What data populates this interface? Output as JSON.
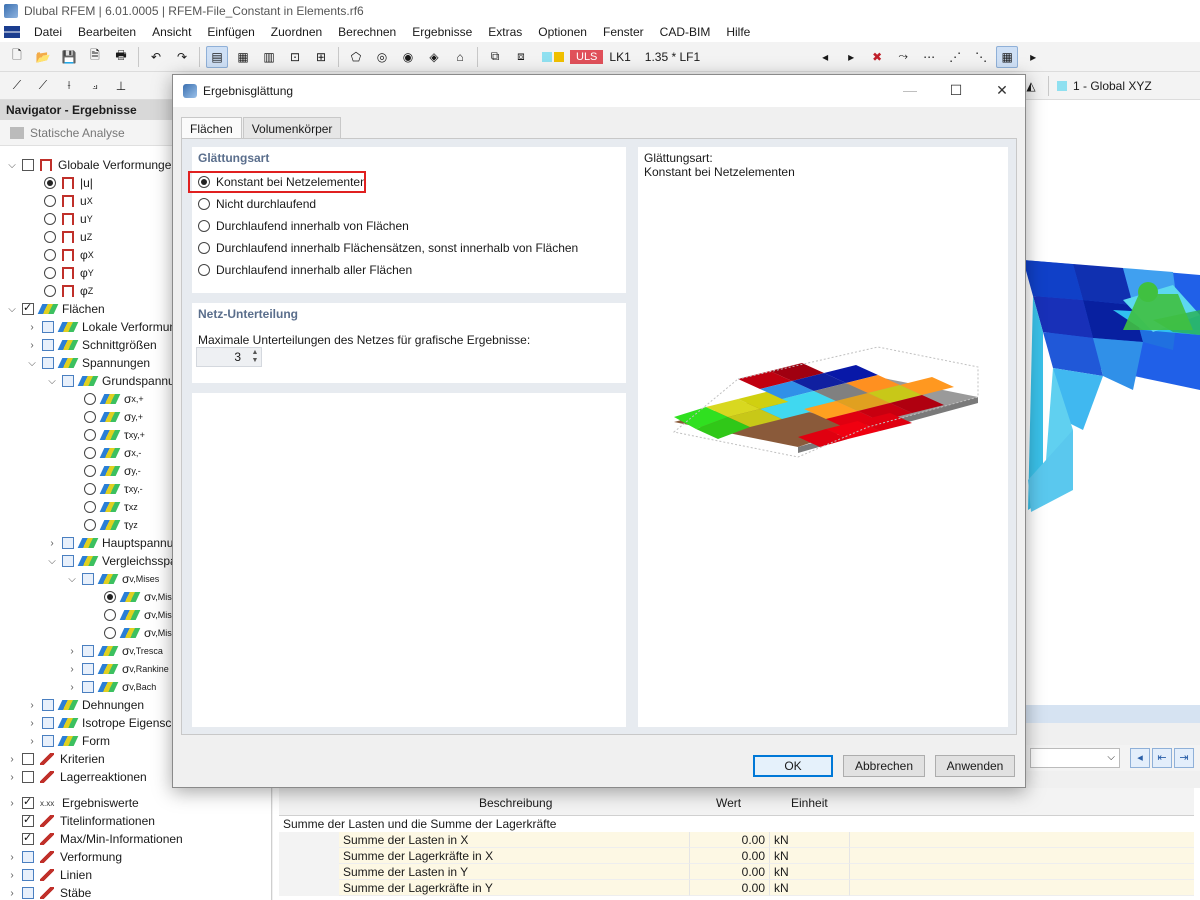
{
  "app_title": "Dlubal RFEM | 6.01.0005 | RFEM-File_Constant in Elements.rf6",
  "menu": [
    "Datei",
    "Bearbeiten",
    "Ansicht",
    "Einfügen",
    "Zuordnen",
    "Berechnen",
    "Ergebnisse",
    "Extras",
    "Optionen",
    "Fenster",
    "CAD-BIM",
    "Hilfe"
  ],
  "toolbar": {
    "uls": "ULS",
    "load_case": "LK1",
    "combination": "1.35 * LF1",
    "view_label": "1 - Global XYZ"
  },
  "navigator": {
    "title": "Navigator - Ergebnisse",
    "analysis": "Statische Analyse",
    "items": {
      "global_deform": "Globale Verformungen",
      "u_abs": "|u|",
      "ux_base": "u",
      "ux_sub": "X",
      "uy_base": "u",
      "uy_sub": "Y",
      "uz_base": "u",
      "uz_sub": "Z",
      "phix_base": "φ",
      "phix_sub": "X",
      "phiy_base": "φ",
      "phiy_sub": "Y",
      "phiz_base": "φ",
      "phiz_sub": "Z",
      "flaechen": "Flächen",
      "lokale": "Lokale Verformungen",
      "schnitt": "Schnittgrößen",
      "spannungen": "Spannungen",
      "grund": "Grundspannungen",
      "sx_plus_base": "σ",
      "sx_plus_sub": "x,+",
      "sy_plus_base": "σ",
      "sy_plus_sub": "y,+",
      "txy_plus_base": "τ",
      "txy_plus_sub": "xy,+",
      "sx_minus_base": "σ",
      "sx_minus_sub": "x,-",
      "sy_minus_base": "σ",
      "sy_minus_sub": "y,-",
      "txy_minus_base": "τ",
      "txy_minus_sub": "xy,-",
      "txz_base": "τ",
      "txz_sub": "xz",
      "tyz_base": "τ",
      "tyz_sub": "yz",
      "haupt": "Hauptspannungen",
      "vergleich": "Vergleichsspannungen",
      "mises_base": "σ",
      "mises_sub": "v,Mises",
      "mises1_base": "σ",
      "mises1_sub": "v,Mises",
      "mises2_base": "σ",
      "mises2_sub": "v,Mises",
      "mises3_base": "σ",
      "mises3_sub": "v,Mises",
      "tresca_base": "σ",
      "tresca_sub": "v,Tresca",
      "rankine_base": "σ",
      "rankine_sub": "v,Rankine",
      "bach_base": "σ",
      "bach_sub": "v,Bach",
      "dehnungen": "Dehnungen",
      "isotrope": "Isotrope Eigenschaften",
      "form": "Form",
      "kriterien": "Kriterien",
      "lager": "Lagerreaktionen",
      "ergebniswerte": "Ergebniswerte",
      "titel": "Titelinformationen",
      "maxmin": "Max/Min-Informationen",
      "verformung": "Verformung",
      "linien": "Linien",
      "staebe": "Stäbe"
    }
  },
  "dialog": {
    "title": "Ergebnisglättung",
    "tabs": [
      "Flächen",
      "Volumenkörper"
    ],
    "smoothing_group": "Glättungsart",
    "options": [
      "Konstant bei Netzelementen",
      "Nicht durchlaufend",
      "Durchlaufend innerhalb von Flächen",
      "Durchlaufend innerhalb Flächensätzen, sonst innerhalb von Flächen",
      "Durchlaufend innerhalb aller Flächen"
    ],
    "selected_index": 0,
    "mesh_group": "Netz-Unterteilung",
    "mesh_label": "Maximale Unterteilungen des Netzes für grafische Ergebnisse:",
    "mesh_value": "3",
    "preview_label": "Glättungsart:",
    "preview_value": "Konstant bei Netzelementen",
    "buttons": {
      "ok": "OK",
      "cancel": "Abbrechen",
      "apply": "Anwenden"
    }
  },
  "table": {
    "headers": {
      "desc": "Beschreibung",
      "value": "Wert",
      "unit": "Einheit"
    },
    "group": "Summe der Lasten und die Summe der Lagerkräfte",
    "rows": [
      {
        "desc": "Summe der Lasten in X",
        "value": "0.00",
        "unit": "kN"
      },
      {
        "desc": "Summe der Lagerkräfte in X",
        "value": "0.00",
        "unit": "kN"
      },
      {
        "desc": "Summe der Lasten in Y",
        "value": "0.00",
        "unit": "kN"
      },
      {
        "desc": "Summe der Lagerkräfte in Y",
        "value": "0.00",
        "unit": "kN"
      }
    ]
  },
  "colors": {
    "highlight": "#e02020",
    "accent": "#0078d7"
  }
}
